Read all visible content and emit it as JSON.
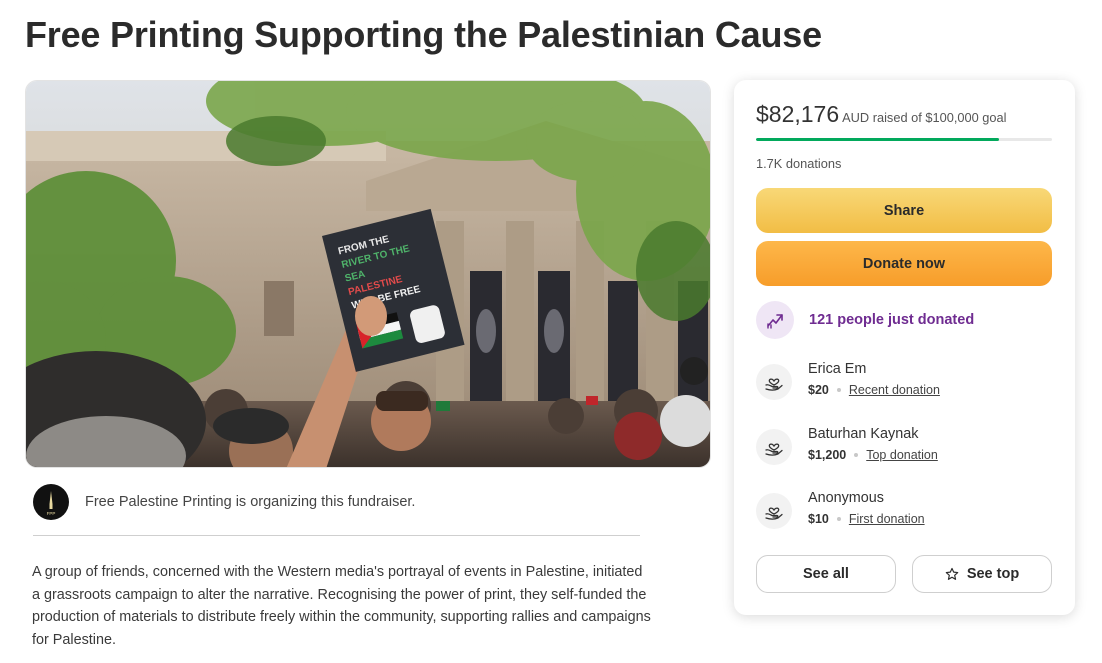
{
  "page": {
    "title": "Free Printing Supporting the Palestinian Cause"
  },
  "hero": {
    "sign_lines": [
      "FROM THE",
      "RIVER TO THE",
      "SEA",
      "PALESTINE",
      "WILL BE FREE"
    ],
    "icon": "protest-photo"
  },
  "organizer": {
    "text": "Free Palestine Printing is organizing this fundraiser.",
    "avatar_icon": "organizer-logo",
    "avatar_initials": "FPP"
  },
  "story": {
    "text": "A group of friends, concerned with the Western media's portrayal of events in Palestine, initiated a grassroots campaign to alter the narrative. Recognising the power of print, they self-funded the production of materials to distribute freely within the community, supporting rallies and campaigns for Palestine."
  },
  "donation_card": {
    "amount": "$82,176",
    "goal_text": "AUD raised of $100,000 goal",
    "progress_fraction": 0.82176,
    "progress_color": "#02a95c",
    "donation_count": "1.7K donations",
    "share_label": "Share",
    "donate_label": "Donate now",
    "just_donated": "121 people just donated",
    "accent_purple": "#6f2c91",
    "donors": [
      {
        "name": "Erica Em",
        "amount": "$20",
        "type": "Recent donation",
        "icon": "heart-hand-icon"
      },
      {
        "name": "Baturhan Kaynak",
        "amount": "$1,200",
        "type": "Top donation",
        "icon": "heart-hand-icon"
      },
      {
        "name": "Anonymous",
        "amount": "$10",
        "type": "First donation",
        "icon": "heart-hand-icon"
      }
    ],
    "see_all_label": "See all",
    "see_top_label": "See top"
  }
}
